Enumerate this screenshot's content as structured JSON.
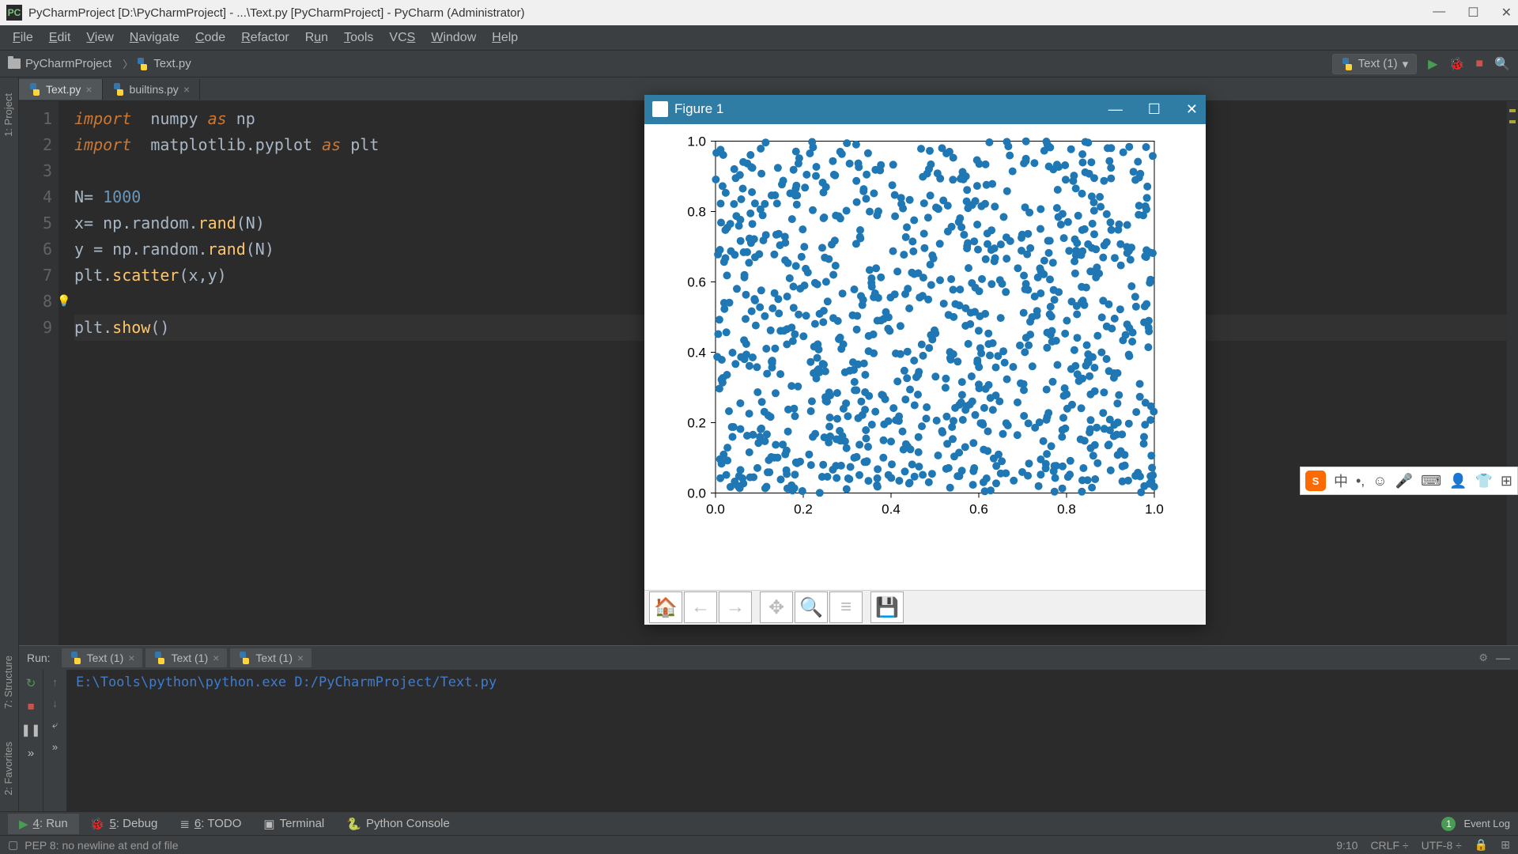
{
  "titlebar": {
    "title": "PyCharmProject [D:\\PyCharmProject] - ...\\Text.py [PyCharmProject] - PyCharm (Administrator)"
  },
  "menu": [
    "File",
    "Edit",
    "View",
    "Navigate",
    "Code",
    "Refactor",
    "Run",
    "Tools",
    "VCS",
    "Window",
    "Help"
  ],
  "breadcrumb": {
    "project": "PyCharmProject",
    "file": "Text.py"
  },
  "runconfig": "Text (1)",
  "editor_tabs": [
    {
      "label": "Text.py",
      "active": true
    },
    {
      "label": "builtins.py",
      "active": false
    }
  ],
  "code_lines": 9,
  "code": {
    "l1": {
      "kw1": "import",
      "mod": "numpy",
      "kw2": "as",
      "alias": "np"
    },
    "l2": {
      "kw1": "import",
      "mod": "matplotlib.pyplot",
      "kw2": "as",
      "alias": "plt"
    },
    "l4": {
      "var": "N",
      "op": "=",
      "val": "1000"
    },
    "l5": {
      "var": "x",
      "op": "=",
      "expr1": "np.random.",
      "fn": "rand",
      "expr2": "(N)"
    },
    "l6": {
      "var": "y",
      "op": " = ",
      "expr1": "np.random.",
      "fn": "rand",
      "expr2": "(N)"
    },
    "l7": {
      "obj": "plt.",
      "fn": "scatter",
      "args": "(x,y)"
    },
    "l9": {
      "obj": "plt.",
      "fn": "show",
      "args": "()"
    }
  },
  "sidetabs": {
    "project": "1: Project",
    "structure": "7: Structure",
    "favorites": "2: Favorites"
  },
  "runwin": {
    "title": "Run:",
    "tabs": [
      "Text (1)",
      "Text (1)",
      "Text (1)"
    ],
    "output": "E:\\Tools\\python\\python.exe D:/PyCharmProject/Text.py"
  },
  "bottom_tools": [
    {
      "icon": "▶",
      "label": "4: Run",
      "active": true
    },
    {
      "icon": "🐞",
      "label": "5: Debug"
    },
    {
      "icon": "≣",
      "label": "6: TODO"
    },
    {
      "icon": "▣",
      "label": "Terminal"
    },
    {
      "icon": "🐍",
      "label": "Python Console"
    }
  ],
  "event_log": "Event Log",
  "statusbar": {
    "msg": "PEP 8: no newline at end of file",
    "cursor": "9:10",
    "lineend": "CRLF",
    "enc": "UTF-8"
  },
  "figure": {
    "title": "Figure 1",
    "x_ticks": [
      "0.0",
      "0.2",
      "0.4",
      "0.6",
      "0.8",
      "1.0"
    ],
    "y_ticks": [
      "0.0",
      "0.2",
      "0.4",
      "0.6",
      "0.8",
      "1.0"
    ]
  },
  "chart_data": {
    "type": "scatter",
    "title": "",
    "xlabel": "",
    "ylabel": "",
    "xlim": [
      0.0,
      1.0
    ],
    "ylim": [
      0.0,
      1.0
    ],
    "n_points": 1000,
    "note": "x ~ Uniform(0,1), y ~ Uniform(0,1); 1000 random points"
  }
}
